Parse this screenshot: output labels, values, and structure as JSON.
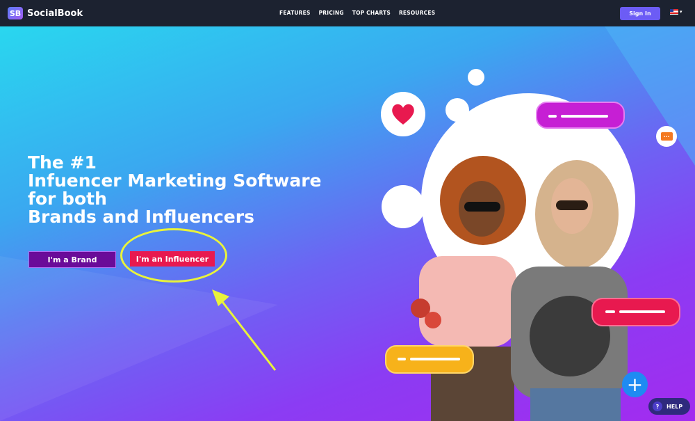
{
  "nav": {
    "logo_mark": "SB",
    "logo_text": "SocialBook",
    "links": [
      "FEATURES",
      "PRICING",
      "TOP CHARTS",
      "RESOURCES"
    ],
    "signin_label": "Sign In",
    "language_icon": "us-flag-icon"
  },
  "hero": {
    "headline_lines": [
      "The #1",
      "Infuencer Marketing Software",
      "for both",
      "Brands and Influencers"
    ],
    "brand_button": "I'm a Brand",
    "influencer_button": "I'm an Influencer"
  },
  "widgets": {
    "help_label": "HELP",
    "help_icon_glyph": "?",
    "plus_glyph": "+"
  },
  "colors": {
    "nav_bg": "#1c2230",
    "signin_bg": "#6c5cf5",
    "brand_button_bg": "#6a0b99",
    "influencer_button_bg": "#e8194f",
    "annotation_yellow": "#e9f33a"
  }
}
